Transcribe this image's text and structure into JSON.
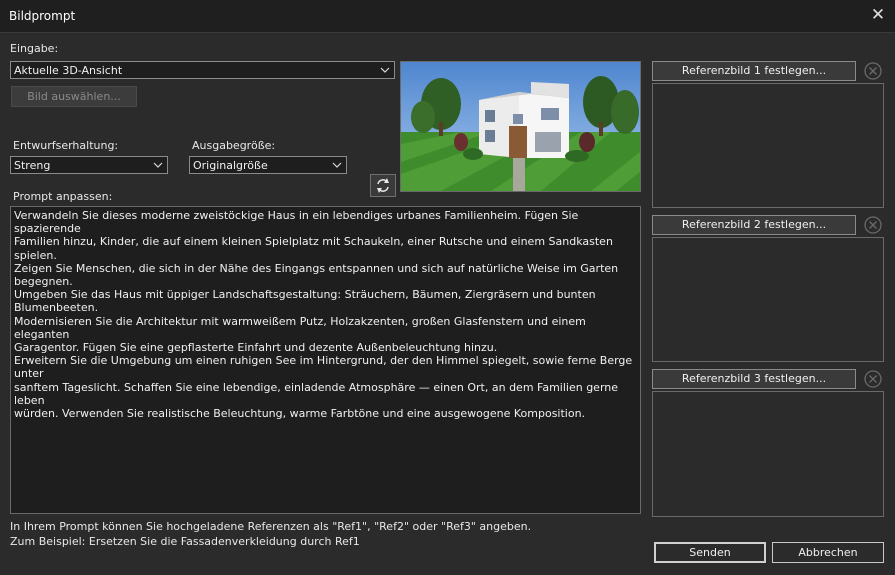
{
  "window": {
    "title": "Bildprompt",
    "close_icon": "close-icon"
  },
  "input": {
    "label": "Eingabe:",
    "source_value": "Aktuelle 3D-Ansicht",
    "select_image_label": "Bild auswählen..."
  },
  "design_retention": {
    "label": "Entwurfserhaltung:",
    "value": "Streng"
  },
  "output_size": {
    "label": "Ausgabegröße:",
    "value": "Originalgröße"
  },
  "prompt": {
    "label": "Prompt anpassen:",
    "text": "Verwandeln Sie dieses moderne zweistöckige Haus in ein lebendiges urbanes Familienheim. Fügen Sie spazierende\nFamilien hinzu, Kinder, die auf einem kleinen Spielplatz mit Schaukeln, einer Rutsche und einem Sandkasten spielen.\nZeigen Sie Menschen, die sich in der Nähe des Eingangs entspannen und sich auf natürliche Weise im Garten begegnen.\nUmgeben Sie das Haus mit üppiger Landschaftsgestaltung: Sträuchern, Bäumen, Ziergräsern und bunten Blumenbeeten.\nModernisieren Sie die Architektur mit warmweißem Putz, Holzakzenten, großen Glasfenstern und einem eleganten\nGaragentor. Fügen Sie eine gepflasterte Einfahrt und dezente Außenbeleuchtung hinzu.\nErweitern Sie die Umgebung um einen ruhigen See im Hintergrund, der den Himmel spiegelt, sowie ferne Berge unter\nsanftem Tageslicht. Schaffen Sie eine lebendige, einladende Atmosphäre — einen Ort, an dem Familien gerne leben\nwürden. Verwenden Sie realistische Beleuchtung, warme Farbtöne und eine ausgewogene Komposition."
  },
  "references": [
    {
      "label": "Referenzbild 1 festlegen..."
    },
    {
      "label": "Referenzbild 2 festlegen..."
    },
    {
      "label": "Referenzbild 3 festlegen..."
    }
  ],
  "hints": {
    "line1": "In Ihrem Prompt können Sie hochgeladene Referenzen als \"Ref1\", \"Ref2\" oder \"Ref3\" angeben.",
    "line2": "Zum Beispiel: Ersetzen Sie die Fassadenverkleidung durch Ref1"
  },
  "actions": {
    "send_label": "Senden",
    "cancel_label": "Abbrechen"
  }
}
